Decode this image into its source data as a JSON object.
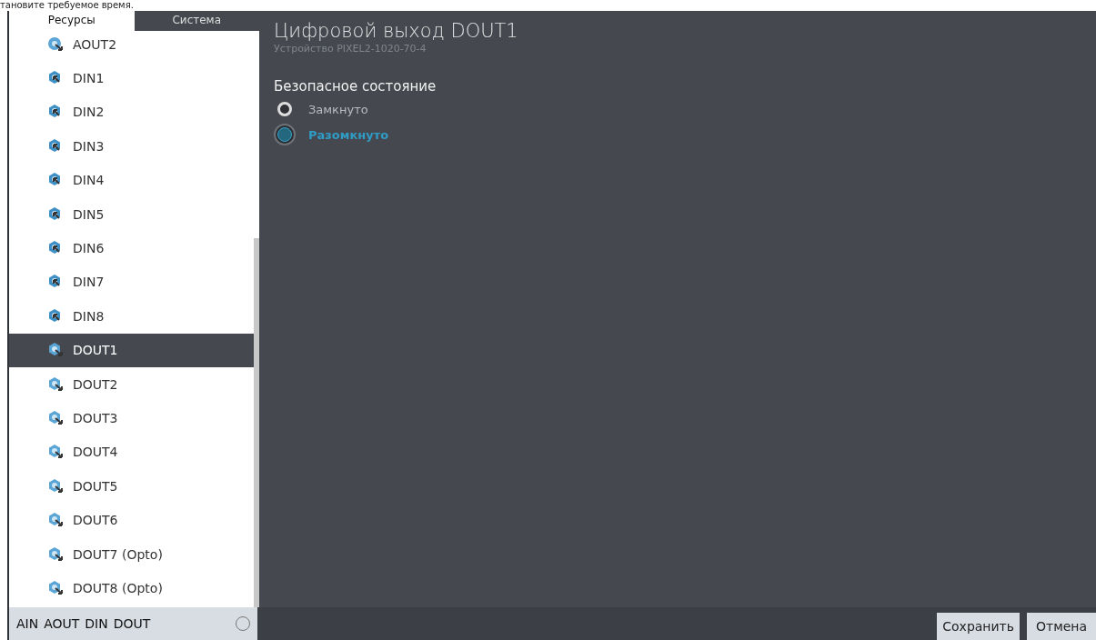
{
  "top_text": "тановите требуемое время.",
  "tabs": [
    {
      "label": "Ресурсы",
      "selected": true
    },
    {
      "label": "Система",
      "selected": false
    }
  ],
  "items": [
    {
      "label": "AOUT2",
      "kind": "aout",
      "selected": false
    },
    {
      "label": "DIN1",
      "kind": "din",
      "selected": false
    },
    {
      "label": "DIN2",
      "kind": "din",
      "selected": false
    },
    {
      "label": "DIN3",
      "kind": "din",
      "selected": false
    },
    {
      "label": "DIN4",
      "kind": "din",
      "selected": false
    },
    {
      "label": "DIN5",
      "kind": "din",
      "selected": false
    },
    {
      "label": "DIN6",
      "kind": "din",
      "selected": false
    },
    {
      "label": "DIN7",
      "kind": "din",
      "selected": false
    },
    {
      "label": "DIN8",
      "kind": "din",
      "selected": false
    },
    {
      "label": "DOUT1",
      "kind": "dout",
      "selected": true
    },
    {
      "label": "DOUT2",
      "kind": "dout",
      "selected": false
    },
    {
      "label": "DOUT3",
      "kind": "dout",
      "selected": false
    },
    {
      "label": "DOUT4",
      "kind": "dout",
      "selected": false
    },
    {
      "label": "DOUT5",
      "kind": "dout",
      "selected": false
    },
    {
      "label": "DOUT6",
      "kind": "dout",
      "selected": false
    },
    {
      "label": "DOUT7 (Opto)",
      "kind": "dout",
      "selected": false
    },
    {
      "label": "DOUT8 (Opto)",
      "kind": "dout",
      "selected": false
    }
  ],
  "filter": {
    "labels": [
      "AIN",
      "AOUT",
      "DIN",
      "DOUT"
    ],
    "checked": false
  },
  "detail": {
    "title": "Цифровой выход DOUT1",
    "subtitle": "Устройство PIXEL2-1020-70-4",
    "section": "Безопасное состояние",
    "options": [
      {
        "label": "Замкнуто",
        "selected": false
      },
      {
        "label": "Разомкнуто",
        "selected": true
      }
    ]
  },
  "buttons": [
    "Сохранить",
    "Отмена"
  ]
}
